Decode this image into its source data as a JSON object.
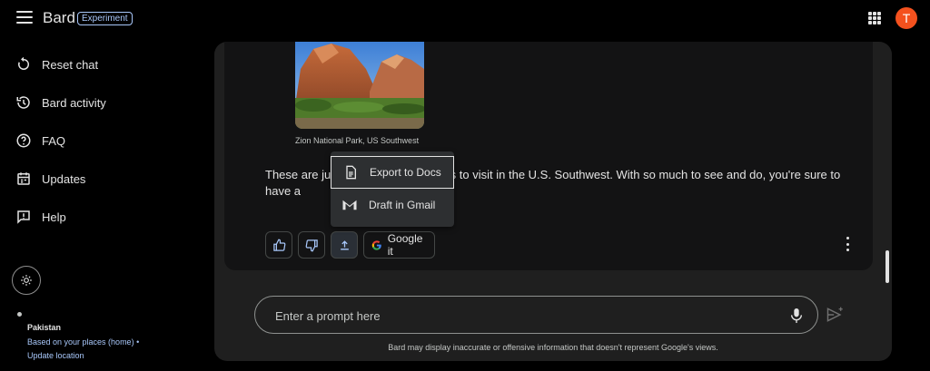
{
  "header": {
    "app_name": "Bard",
    "badge": "Experiment",
    "avatar_letter": "T"
  },
  "sidebar": {
    "items": [
      {
        "label": "Reset chat",
        "icon": "reset-icon"
      },
      {
        "label": "Bard activity",
        "icon": "history-icon"
      },
      {
        "label": "FAQ",
        "icon": "help-circle-icon"
      },
      {
        "label": "Updates",
        "icon": "calendar-icon"
      },
      {
        "label": "Help",
        "icon": "feedback-icon"
      }
    ],
    "location": {
      "country": "Pakistan",
      "based_on": "Based on your places (home) •",
      "update_link": "Update location"
    }
  },
  "response": {
    "image_caption": "Zion National Park, US Southwest",
    "text_before": "These are jus",
    "text_after": "tiful places to visit in the U.S. Southwest. With so much to see and do, you're sure to have a",
    "google_it_label": "Google it"
  },
  "export_menu": {
    "items": [
      {
        "label": "Export to Docs",
        "icon": "docs-icon"
      },
      {
        "label": "Draft in Gmail",
        "icon": "gmail-icon"
      }
    ]
  },
  "prompt": {
    "placeholder": "Enter a prompt here"
  },
  "footer": {
    "disclaimer": "Bard may display inaccurate or offensive information that doesn't represent Google's views."
  },
  "colors": {
    "accent_blue": "#a8c7fa",
    "avatar_bg": "#f4511e",
    "panel_bg": "#1f1f1f",
    "card_bg": "#131314"
  }
}
